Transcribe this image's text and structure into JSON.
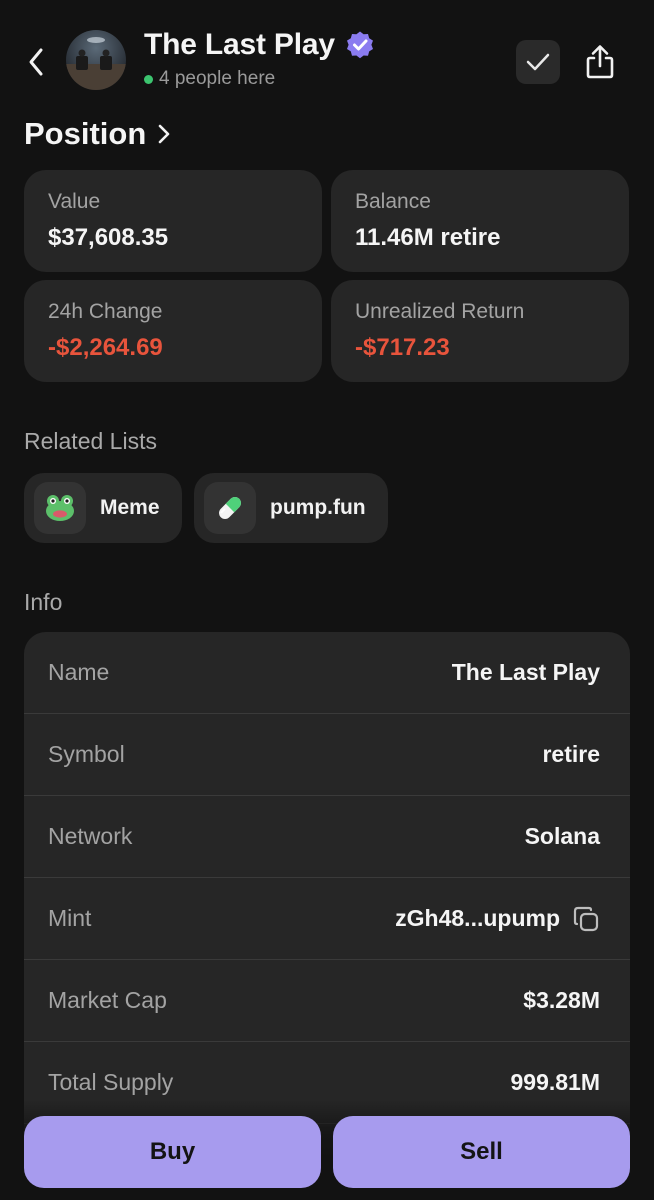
{
  "header": {
    "title": "The Last Play",
    "presence_text": "4 people here",
    "verified": true
  },
  "position": {
    "heading": "Position",
    "cards": [
      {
        "label": "Value",
        "value": "$37,608.35",
        "tone": "neutral"
      },
      {
        "label": "Balance",
        "value": "11.46M retire",
        "tone": "neutral"
      },
      {
        "label": "24h Change",
        "value": "-$2,264.69",
        "tone": "negative"
      },
      {
        "label": "Unrealized Return",
        "value": "-$717.23",
        "tone": "negative"
      }
    ]
  },
  "related_lists": {
    "heading": "Related Lists",
    "items": [
      {
        "label": "Meme",
        "icon": "frog-icon"
      },
      {
        "label": "pump.fun",
        "icon": "pill-icon"
      }
    ]
  },
  "info": {
    "heading": "Info",
    "rows": [
      {
        "key": "Name",
        "value": "The Last Play"
      },
      {
        "key": "Symbol",
        "value": "retire"
      },
      {
        "key": "Network",
        "value": "Solana"
      },
      {
        "key": "Mint",
        "value": "zGh48...upump",
        "copyable": true
      },
      {
        "key": "Market Cap",
        "value": "$3.28M"
      },
      {
        "key": "Total Supply",
        "value": "999.81M"
      }
    ]
  },
  "actions": {
    "buy_label": "Buy",
    "sell_label": "Sell"
  },
  "colors": {
    "background": "#121212",
    "card": "#262626",
    "accent": "#a79bee",
    "negative": "#e8543c",
    "online": "#3cc46f",
    "verified": "#8b7cf0"
  }
}
